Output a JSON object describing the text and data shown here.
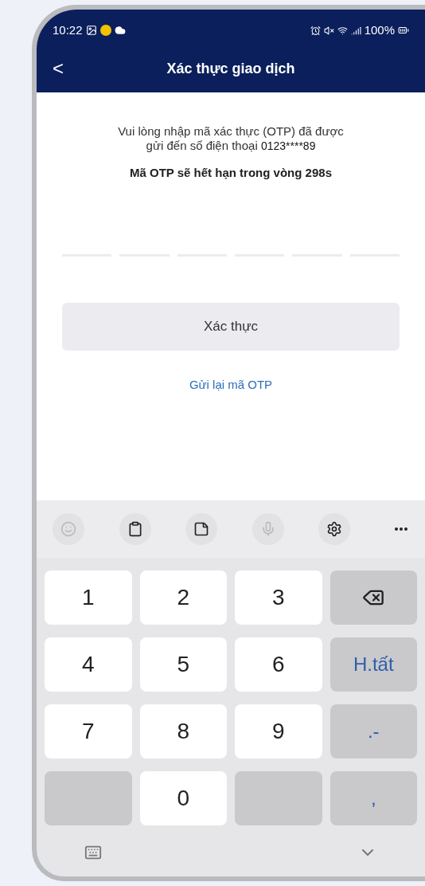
{
  "status_bar": {
    "time": "10:22",
    "battery": "100%"
  },
  "header": {
    "back": "<",
    "title": "Xác thực giao dịch"
  },
  "message": {
    "text": "Vui lòng nhập mã xác thực (OTP) đã được gửi đến số điện thoại",
    "phone": "0123****89"
  },
  "expiry": {
    "text": "Mã OTP sẽ hết hạn trong vòng",
    "seconds": "298s"
  },
  "otp_slots": [
    {
      "filled": false
    },
    {
      "filled": false
    },
    {
      "filled": false
    },
    {
      "filled": false
    },
    {
      "filled": false
    },
    {
      "filled": false
    }
  ],
  "confirm_button": {
    "label": "Xác thực",
    "disabled": true
  },
  "resend_link": "Gửi lại mã OTP",
  "keyboard_toolbar": [
    {
      "kind": "emoji",
      "disabled": true
    },
    {
      "kind": "clipboard",
      "disabled": false
    },
    {
      "kind": "notes",
      "disabled": false
    },
    {
      "kind": "mic",
      "disabled": true
    },
    {
      "kind": "settings",
      "disabled": false
    },
    {
      "kind": "more",
      "disabled": false
    }
  ],
  "keys": [
    {
      "kind": "digit",
      "label": "1"
    },
    {
      "kind": "digit",
      "label": "2"
    },
    {
      "kind": "digit",
      "label": "3"
    },
    {
      "kind": "backspace"
    },
    {
      "kind": "digit",
      "label": "4"
    },
    {
      "kind": "digit",
      "label": "5"
    },
    {
      "kind": "digit",
      "label": "6"
    },
    {
      "kind": "function",
      "label": "H.tất"
    },
    {
      "kind": "digit",
      "label": "7"
    },
    {
      "kind": "digit",
      "label": "8"
    },
    {
      "kind": "digit",
      "label": "9"
    },
    {
      "kind": "function",
      "label": ".-"
    },
    {
      "kind": "blank"
    },
    {
      "kind": "digit",
      "label": "0"
    },
    {
      "kind": "blank"
    },
    {
      "kind": "function",
      "label": ","
    }
  ]
}
